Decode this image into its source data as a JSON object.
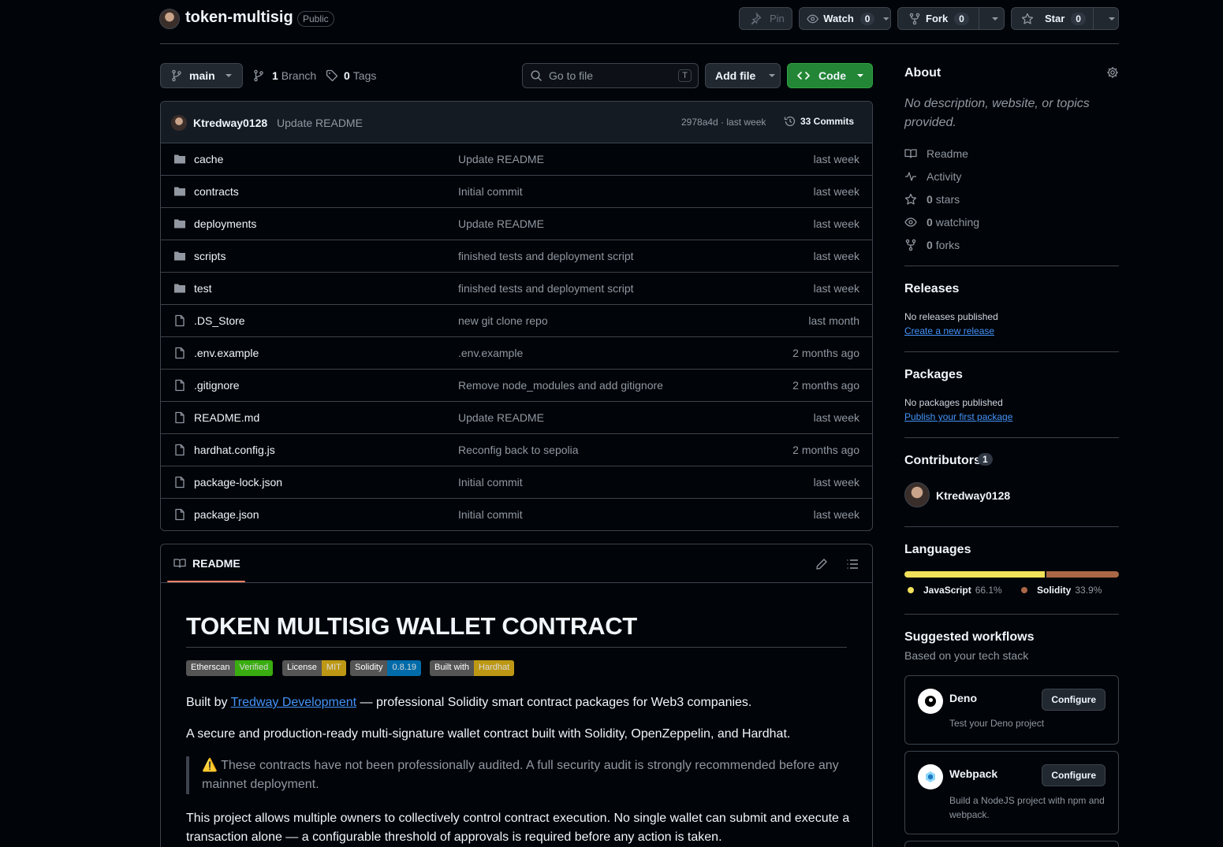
{
  "header": {
    "repo_name": "token-multisig",
    "visibility": "Public",
    "pin_label": "Pin",
    "watch_label": "Watch",
    "watch_count": "0",
    "fork_label": "Fork",
    "fork_count": "0",
    "star_label": "Star",
    "star_count": "0"
  },
  "toolbar": {
    "branch": "main",
    "branch_count": "1",
    "branch_label": "Branch",
    "tag_count": "0",
    "tag_label": "Tags",
    "search_placeholder": "Go to file",
    "search_shortcut": "T",
    "add_file_label": "Add file",
    "code_label": "Code"
  },
  "commit": {
    "author": "Ktredway0128",
    "message": "Update README",
    "hash_time": "2978a4d · last week",
    "commits_label": "33 Commits"
  },
  "files": [
    {
      "name": "cache",
      "type": "folder",
      "message": "Update README",
      "date": "last week"
    },
    {
      "name": "contracts",
      "type": "folder",
      "message": "Initial commit",
      "date": "last week"
    },
    {
      "name": "deployments",
      "type": "folder",
      "message": "Update README",
      "date": "last week"
    },
    {
      "name": "scripts",
      "type": "folder",
      "message": "finished tests and deployment script",
      "date": "last week"
    },
    {
      "name": "test",
      "type": "folder",
      "message": "finished tests and deployment script",
      "date": "last week"
    },
    {
      "name": ".DS_Store",
      "type": "file",
      "message": "new git clone repo",
      "date": "last month"
    },
    {
      "name": ".env.example",
      "type": "file",
      "message": ".env.example",
      "date": "2 months ago"
    },
    {
      "name": ".gitignore",
      "type": "file",
      "message": "Remove node_modules and add gitignore",
      "date": "2 months ago"
    },
    {
      "name": "README.md",
      "type": "file",
      "message": "Update README",
      "date": "last week"
    },
    {
      "name": "hardhat.config.js",
      "type": "file",
      "message": "Reconfig back to sepolia",
      "date": "2 months ago"
    },
    {
      "name": "package-lock.json",
      "type": "file",
      "message": "Initial commit",
      "date": "last week"
    },
    {
      "name": "package.json",
      "type": "file",
      "message": "Initial commit",
      "date": "last week"
    }
  ],
  "readme": {
    "tab_label": "README",
    "title": "TOKEN MULTISIG WALLET CONTRACT",
    "badges": [
      {
        "left": "Etherscan",
        "right": "Verified",
        "color": "#4c1"
      },
      {
        "left": "License",
        "right": "MIT",
        "color": "#dfb317"
      },
      {
        "left": "Solidity",
        "right": "0.8.19",
        "color": "#007ec6"
      },
      {
        "left": "Built with",
        "right": "Hardhat",
        "color": "#dfb317"
      }
    ],
    "p1_prefix": "Built by ",
    "p1_link": "Tredway Development",
    "p1_suffix": " — professional Solidity smart contract packages for Web3 companies.",
    "p2": "A secure and production-ready multi-signature wallet contract built with Solidity, OpenZeppelin, and Hardhat.",
    "warning_emoji": "⚠️",
    "warning": " These contracts have not been professionally audited. A full security audit is strongly recommended before any mainnet deployment.",
    "p3": "This project allows multiple owners to collectively control contract execution. No single wallet can submit and execute a transaction alone — a configurable threshold of approvals is required before any action is taken."
  },
  "about": {
    "heading": "About",
    "description": "No description, website, or topics provided.",
    "readme_label": "Readme",
    "activity_label": "Activity",
    "stars_count": "0",
    "stars_label": "stars",
    "watching_count": "0",
    "watching_label": "watching",
    "forks_count": "0",
    "forks_label": "forks"
  },
  "releases": {
    "heading": "Releases",
    "empty": "No releases published",
    "link": "Create a new release"
  },
  "packages": {
    "heading": "Packages",
    "empty": "No packages published",
    "link": "Publish your first package"
  },
  "contributors": {
    "heading": "Contributors",
    "count": "1",
    "user": "Ktredway0128"
  },
  "languages": {
    "heading": "Languages",
    "items": [
      {
        "name": "JavaScript",
        "percent": "66.1%",
        "value": 66.1,
        "color": "#f1e05a"
      },
      {
        "name": "Solidity",
        "percent": "33.9%",
        "value": 33.9,
        "color": "#aa6746"
      }
    ]
  },
  "workflows": {
    "heading": "Suggested workflows",
    "subheading": "Based on your tech stack",
    "items": [
      {
        "name": "Deno",
        "description": "Test your Deno project",
        "button": "Configure"
      },
      {
        "name": "Webpack",
        "description": "Build a NodeJS project with npm and webpack.",
        "button": "Configure"
      }
    ]
  },
  "colors": {
    "accent_green": "#238636",
    "link_blue": "#4493f8",
    "tab_underline": "#f78166"
  }
}
